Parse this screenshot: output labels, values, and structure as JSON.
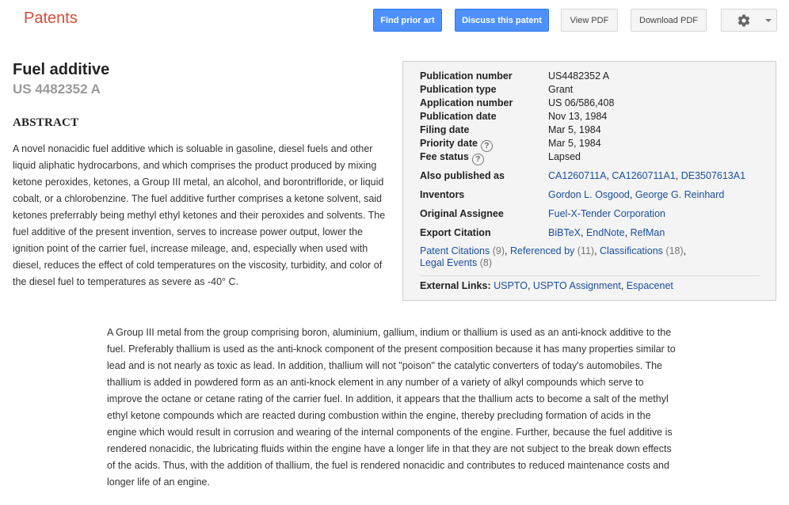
{
  "header": {
    "brand": "Patents",
    "buttons": {
      "find_prior_art": "Find prior art",
      "discuss": "Discuss this patent",
      "view_pdf": "View PDF",
      "download_pdf": "Download PDF"
    },
    "settings_icon": "gear-icon"
  },
  "patent": {
    "title": "Fuel additive",
    "number": "US 4482352 A"
  },
  "abstract": {
    "heading": "ABSTRACT",
    "text": "A novel nonacidic fuel additive which is soluable in gasoline, diesel fuels and other liquid aliphatic hydrocarbons, and which comprises the product produced by mixing ketone peroxides, ketones, a Group III metal, an alcohol, and borontrifloride, or liquid cobalt, or a chlorobenzine. The fuel additive further comprises a ketone solvent, said ketones preferrably being methyl ethyl ketones and their peroxides and solvents. The fuel additive of the present invention, serves to increase power output, lower the ignition point of the carrier fuel, increase mileage, and, especially when used with diesel, reduces the effect of cold temperatures on the viscosity, turbidity, and color of the diesel fuel to temperatures as severe as -40° C."
  },
  "metadata": {
    "publication_number": {
      "label": "Publication number",
      "value": "US4482352 A"
    },
    "publication_type": {
      "label": "Publication type",
      "value": "Grant"
    },
    "application_number": {
      "label": "Application number",
      "value": "US 06/586,408"
    },
    "publication_date": {
      "label": "Publication date",
      "value": "Nov 13, 1984"
    },
    "filing_date": {
      "label": "Filing date",
      "value": "Mar 5, 1984"
    },
    "priority_date": {
      "label": "Priority date",
      "value": "Mar 5, 1984"
    },
    "fee_status": {
      "label": "Fee status",
      "value": "Lapsed"
    },
    "help_glyph": "?",
    "also_published": {
      "label": "Also published as",
      "links": [
        "CA1260711A",
        "CA1260711A1",
        "DE3507613A1"
      ]
    },
    "inventors": {
      "label": "Inventors",
      "links": [
        "Gordon L. Osgood",
        "George G. Reinhard"
      ]
    },
    "assignee": {
      "label": "Original Assignee",
      "link": "Fuel-X-Tender Corporation"
    },
    "export": {
      "label": "Export Citation",
      "links": [
        "BiBTeX",
        "EndNote",
        "RefMan"
      ]
    },
    "stats": [
      {
        "label": "Patent Citations",
        "count": "(9)"
      },
      {
        "label": "Referenced by",
        "count": "(11)"
      },
      {
        "label": "Classifications",
        "count": "(18)"
      },
      {
        "label": "Legal Events",
        "count": "(8)"
      }
    ],
    "external": {
      "label": "External Links:",
      "links": [
        "USPTO",
        "USPTO Assignment",
        "Espacenet"
      ]
    }
  },
  "description": "A Group III metal from the group comprising boron, aluminium, gallium, indium or thallium is used as an anti-knock additive to the fuel. Preferably thallium is used as the anti-knock component of the present composition because it has many properties similar to lead and is not nearly as toxic as lead. In addition, thallium will not \"poison\" the catalytic converters of today's automobiles. The thallium is added in powdered form as an anti-knock element in any number of a variety of alkyl compounds which serve to improve the octane or cetane rating of the carrier fuel. In addition, it appears that the thallium acts to become a salt of the methyl ethyl ketone compounds which are reacted during combustion within the engine, thereby precluding formation of acids in the engine which would result in corrusion and wearing of the internal components of the engine. Further, because the fuel additive is rendered nonacidic, the lubricating fluids within the engine have a longer life in that they are not subject to the break down effects of the acids. Thus, with the addition of thallium, the fuel is rendered nonacidic and contributes to reduced maintenance costs and longer life of an engine."
}
